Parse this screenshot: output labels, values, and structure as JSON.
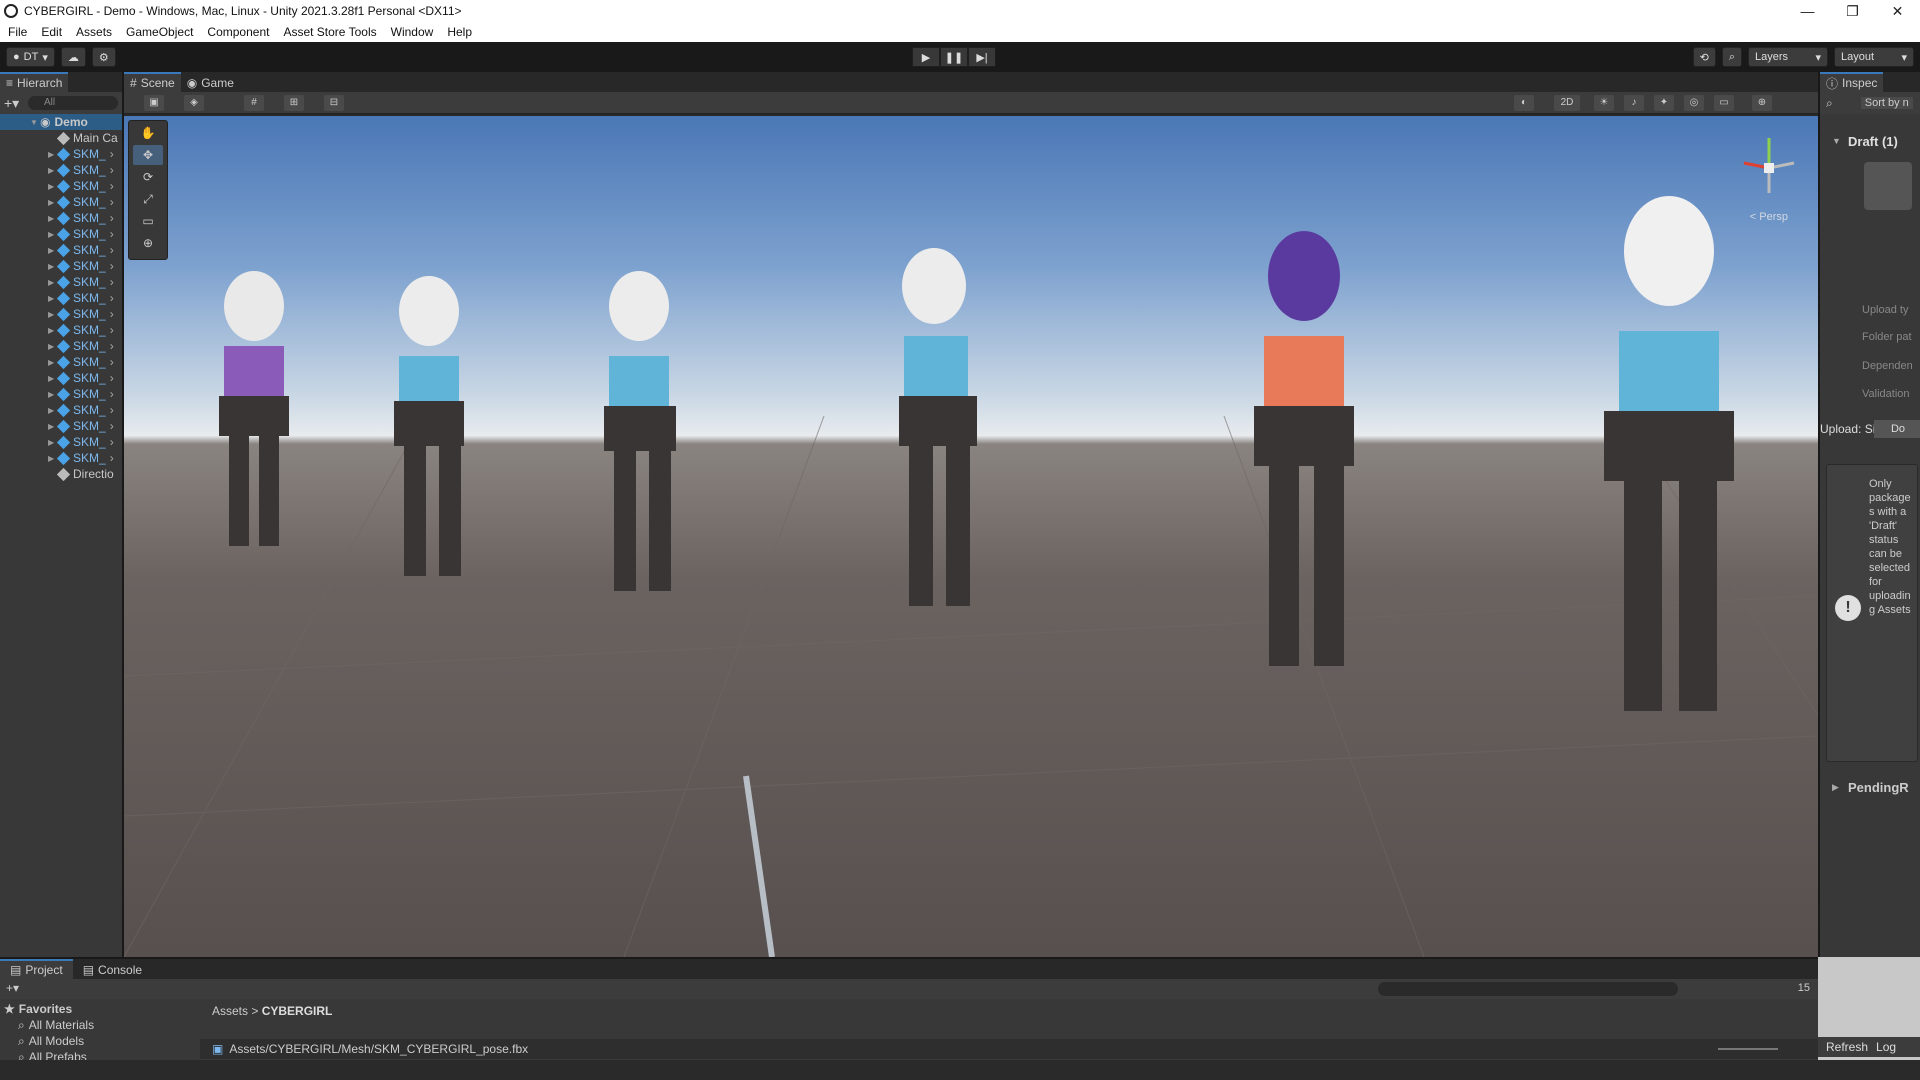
{
  "window": {
    "title": "CYBERGIRL - Demo - Windows, Mac, Linux - Unity 2021.3.28f1 Personal <DX11>",
    "minimize": "—",
    "maximize": "❐",
    "close": "✕"
  },
  "menu": [
    "File",
    "Edit",
    "Assets",
    "GameObject",
    "Component",
    "Asset Store Tools",
    "Window",
    "Help"
  ],
  "toolbar": {
    "account": "DT",
    "layers": "Layers",
    "layout": "Layout",
    "play": "▶",
    "pause": "❚❚",
    "step": "▶|"
  },
  "hierarchy": {
    "tab": "Hierarch",
    "search_placeholder": "All",
    "root": "Demo",
    "camera": "Main Ca",
    "items": [
      "SKM_",
      "SKM_",
      "SKM_",
      "SKM_",
      "SKM_",
      "SKM_",
      "SKM_",
      "SKM_",
      "SKM_",
      "SKM_",
      "SKM_",
      "SKM_",
      "SKM_",
      "SKM_",
      "SKM_",
      "SKM_",
      "SKM_",
      "SKM_",
      "SKM_",
      "SKM_"
    ],
    "light": "Directio"
  },
  "scene": {
    "tab_scene": "Scene",
    "tab_game": "Game",
    "mode_2d": "2D",
    "persp": "< Persp"
  },
  "inspector": {
    "tab": "Inspec",
    "sort": "Sort by n",
    "title": "Draft (1)",
    "fields": [
      "Upload ty",
      "Folder pat",
      "Dependen",
      "Validation"
    ],
    "upload_label": "Upload: Si",
    "upload_btn": "Do",
    "help": "Only packages with a 'Draft' status can be selected for uploading Assets",
    "pending": "PendingR",
    "refresh": "Refresh",
    "log": "Log"
  },
  "project": {
    "tab_project": "Project",
    "tab_console": "Console",
    "favorites": "Favorites",
    "fav_items": [
      "All Materials",
      "All Models",
      "All Prefabs"
    ],
    "crumb_root": "Assets",
    "crumb_folder": "CYBERGIRL",
    "selected_path": "Assets/CYBERGIRL/Mesh/SKM_CYBERGIRL_pose.fbx",
    "hidden_count": "15"
  },
  "colors": {
    "accent": "#3a79bb",
    "prefab_text": "#7cb8ee",
    "panel": "#383838"
  }
}
